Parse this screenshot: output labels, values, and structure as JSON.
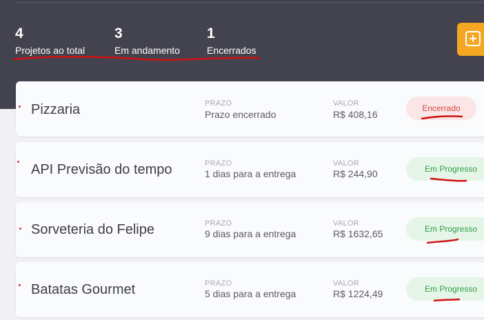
{
  "stats": [
    {
      "number": "4",
      "label": "Projetos ao total"
    },
    {
      "number": "3",
      "label": "Em andamento"
    },
    {
      "number": "1",
      "label": "Encerrados"
    }
  ],
  "add_button": {
    "icon": "plus-icon",
    "color": "#f5a623"
  },
  "projects": [
    {
      "name": "Pizzaria",
      "deadline_label": "PRAZO",
      "deadline": "Prazo encerrado",
      "value_label": "VALOR",
      "value": "R$ 408,16",
      "status": "Encerrado",
      "status_type": "closed"
    },
    {
      "name": "API Previsão do tempo",
      "deadline_label": "PRAZO",
      "deadline": "1 dias para a entrega",
      "value_label": "VALOR",
      "value": "R$ 244,90",
      "status": "Em Progresso",
      "status_type": "progress"
    },
    {
      "name": "Sorveteria do Felipe",
      "deadline_label": "PRAZO",
      "deadline": "9 dias para a entrega",
      "value_label": "VALOR",
      "value": "R$ 1632,65",
      "status": "Em Progresso",
      "status_type": "progress"
    },
    {
      "name": "Batatas Gourmet",
      "deadline_label": "PRAZO",
      "deadline": "5 dias para a entrega",
      "value_label": "VALOR",
      "value": "R$ 1224,49",
      "status": "Em Progresso",
      "status_type": "progress"
    }
  ],
  "colors": {
    "header": "#43434f",
    "accent": "#f5a623",
    "closed": "#d64545",
    "progress": "#2f9e44",
    "annotation": "#d01010"
  }
}
